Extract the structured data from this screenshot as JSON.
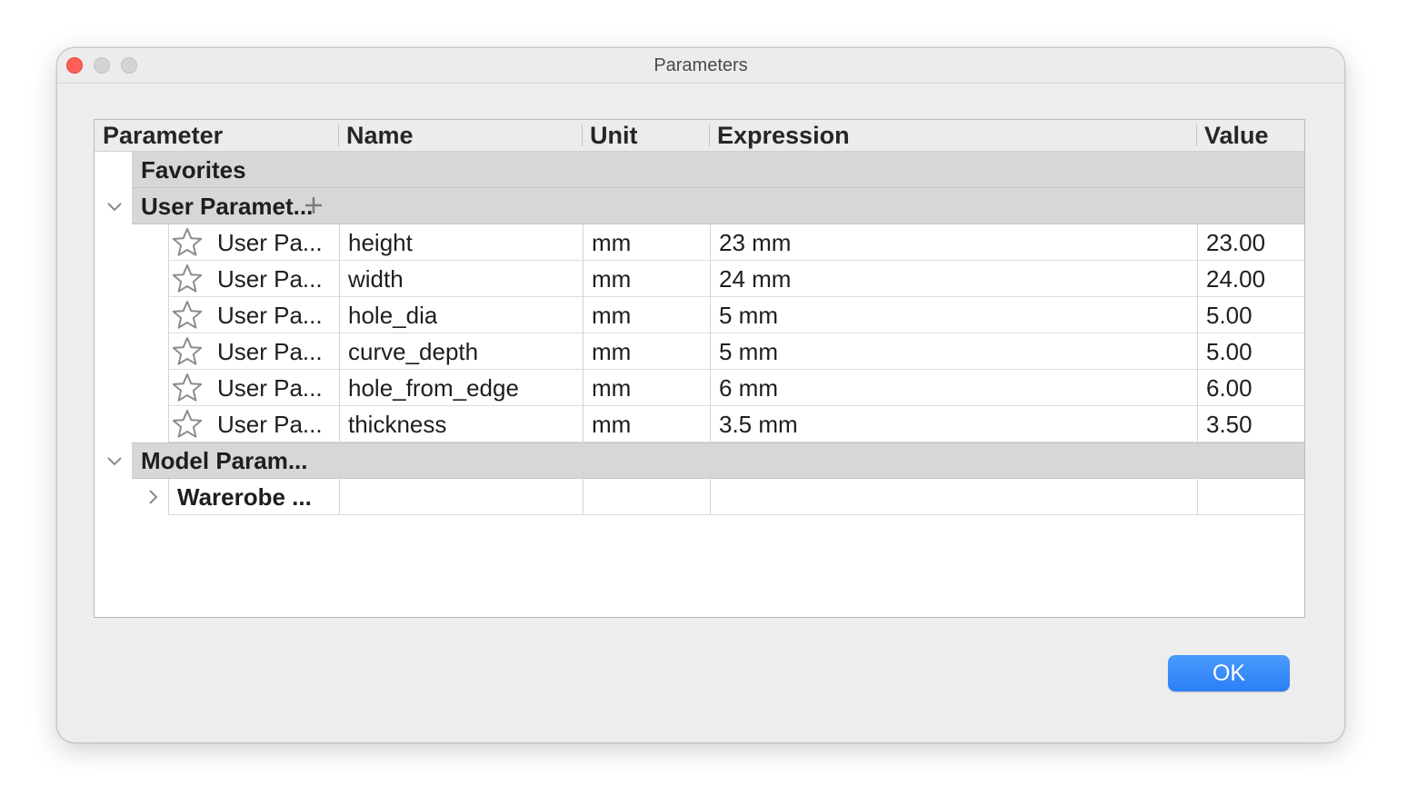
{
  "window": {
    "title": "Parameters"
  },
  "table": {
    "headers": [
      "Parameter",
      "Name",
      "Unit",
      "Expression",
      "Value"
    ],
    "groups": {
      "favorites": {
        "label": "Favorites"
      },
      "user": {
        "label": "User Paramet..."
      },
      "model": {
        "label": "Model Param..."
      }
    },
    "user_rows": [
      {
        "parameter": "User Pa...",
        "name": "height",
        "unit": "mm",
        "expression": "23 mm",
        "value": "23.00"
      },
      {
        "parameter": "User Pa...",
        "name": "width",
        "unit": "mm",
        "expression": "24 mm",
        "value": "24.00"
      },
      {
        "parameter": "User Pa...",
        "name": "hole_dia",
        "unit": "mm",
        "expression": "5 mm",
        "value": "5.00"
      },
      {
        "parameter": "User Pa...",
        "name": "curve_depth",
        "unit": "mm",
        "expression": "5 mm",
        "value": "5.00"
      },
      {
        "parameter": "User Pa...",
        "name": "hole_from_edge",
        "unit": "mm",
        "expression": "6 mm",
        "value": "6.00"
      },
      {
        "parameter": "User Pa...",
        "name": "thickness",
        "unit": "mm",
        "expression": "3.5 mm",
        "value": "3.50"
      }
    ],
    "model_child": {
      "label": "Warerobe ..."
    }
  },
  "footer": {
    "ok_label": "OK"
  },
  "colors": {
    "accent": "#2a7ff5",
    "close": "#fe5f57",
    "group_bg": "#d7d7d7"
  },
  "icons": [
    "star-icon",
    "chevron-down-icon",
    "chevron-right-icon",
    "plus-icon"
  ]
}
